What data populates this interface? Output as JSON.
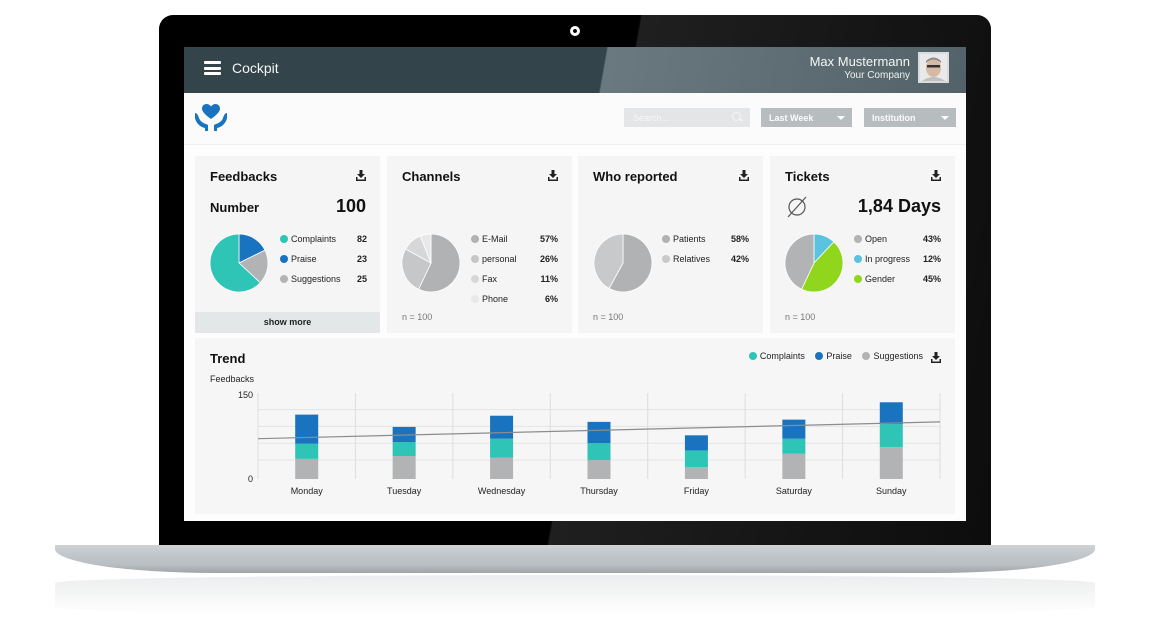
{
  "header": {
    "app_title": "Cockpit",
    "user_name": "Max Mustermann",
    "user_company": "Your Company"
  },
  "toolbar": {
    "search_placeholder": "Search...",
    "period_select": "Last Week",
    "institution_select": "Institution"
  },
  "colors": {
    "complaints": "#2ec4b6",
    "praise": "#1a73be",
    "suggestions": "#b1b3b5",
    "header_bg": "#33444b",
    "accent_blue": "#1a73be"
  },
  "cards": {
    "feedbacks": {
      "title": "Feedbacks",
      "number_label": "Number",
      "number_value": "100",
      "show_more": "show more",
      "legend": [
        {
          "label": "Complaints",
          "value": "82",
          "color": "#2ec4b6"
        },
        {
          "label": "Praise",
          "value": "23",
          "color": "#1a73be"
        },
        {
          "label": "Suggestions",
          "value": "25",
          "color": "#b1b3b5"
        }
      ]
    },
    "channels": {
      "title": "Channels",
      "n_label": "n = 100",
      "legend": [
        {
          "label": "E-Mail",
          "value": "57%",
          "color": "#b1b2b3"
        },
        {
          "label": "personal",
          "value": "26%",
          "color": "#c6c7c8"
        },
        {
          "label": "Fax",
          "value": "11%",
          "color": "#d6d7d8"
        },
        {
          "label": "Phone",
          "value": "6%",
          "color": "#e8e8e8"
        }
      ]
    },
    "who_reported": {
      "title": "Who reported",
      "n_label": "n = 100",
      "legend": [
        {
          "label": "Patients",
          "value": "58%",
          "color": "#b1b2b3"
        },
        {
          "label": "Relatives",
          "value": "42%",
          "color": "#c8c9ca"
        }
      ]
    },
    "tickets": {
      "title": "Tickets",
      "avg_symbol": "∅",
      "avg_value": "1,84 Days",
      "n_label": "n = 100",
      "legend": [
        {
          "label": "Open",
          "value": "43%",
          "color": "#b1b3b5"
        },
        {
          "label": "In progress",
          "value": "12%",
          "color": "#5bc3df"
        },
        {
          "label": "Gender",
          "value": "45%",
          "color": "#8fd61c"
        }
      ]
    }
  },
  "trend": {
    "title": "Trend",
    "legend": [
      {
        "label": "Complaints",
        "color": "#2ec4b6"
      },
      {
        "label": "Praise",
        "color": "#1a73be"
      },
      {
        "label": "Suggestions",
        "color": "#b1b3b5"
      }
    ]
  },
  "chart_data": [
    {
      "type": "pie",
      "title": "Feedbacks",
      "labels": [
        "Complaints",
        "Praise",
        "Suggestions"
      ],
      "values": [
        82,
        23,
        25
      ],
      "colors": [
        "#2ec4b6",
        "#1a73be",
        "#b1b3b5"
      ]
    },
    {
      "type": "pie",
      "title": "Channels",
      "labels": [
        "E-Mail",
        "personal",
        "Fax",
        "Phone"
      ],
      "values": [
        57,
        26,
        11,
        6
      ],
      "colors": [
        "#b1b2b3",
        "#c6c7c8",
        "#d6d7d8",
        "#e8e8e8"
      ]
    },
    {
      "type": "pie",
      "title": "Who reported",
      "labels": [
        "Patients",
        "Relatives"
      ],
      "values": [
        58,
        42
      ],
      "colors": [
        "#b1b2b3",
        "#c8c9ca"
      ]
    },
    {
      "type": "pie",
      "title": "Tickets",
      "labels": [
        "Open",
        "In progress",
        "Gender"
      ],
      "values": [
        43,
        12,
        45
      ],
      "colors": [
        "#b1b3b5",
        "#5bc3df",
        "#8fd61c"
      ]
    },
    {
      "type": "bar",
      "stacked": true,
      "title": "Trend",
      "ylabel": "Feedbacks",
      "xlabel": "",
      "ylim": [
        0,
        150
      ],
      "yticks": [
        "0",
        "150"
      ],
      "grid": true,
      "legend_position": "top-right",
      "categories": [
        "Monday",
        "Tuesday",
        "Wednesday",
        "Thursday",
        "Friday",
        "Saturday",
        "Sunday"
      ],
      "series": [
        {
          "name": "Suggestions",
          "color": "#b1b3b5",
          "values": [
            36,
            41,
            38,
            34,
            21,
            45,
            57
          ]
        },
        {
          "name": "Complaints",
          "color": "#2ec4b6",
          "values": [
            27,
            25,
            34,
            30,
            30,
            27,
            41
          ]
        },
        {
          "name": "Praise",
          "color": "#1a73be",
          "values": [
            52,
            27,
            41,
            38,
            27,
            34,
            39
          ]
        }
      ],
      "trendline": {
        "start": 72,
        "end": 102
      }
    }
  ]
}
